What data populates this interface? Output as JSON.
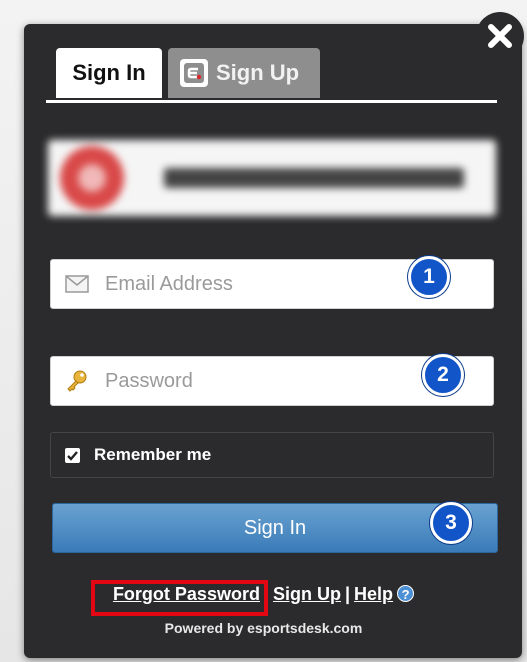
{
  "tabs": [
    {
      "label": "Sign In",
      "active": true
    },
    {
      "label": "Sign Up",
      "active": false
    }
  ],
  "form": {
    "email_placeholder": "Email Address",
    "password_placeholder": "Password",
    "remember_label": "Remember me",
    "remember_checked": true,
    "submit_label": "Sign In"
  },
  "steps": [
    "1",
    "2",
    "3"
  ],
  "footer": {
    "forgot_label": "Forgot Password",
    "signup_label": "Sign Up",
    "help_label": "Help",
    "separator": "|",
    "powered_by": "Powered by esportsdesk.com"
  },
  "colors": {
    "dialog_bg": "#2b2b2d",
    "button_blue": "#3a7bb8",
    "badge_blue": "#1155c8",
    "highlight_red": "#e30613"
  },
  "icons": {
    "close": "close-icon",
    "email": "envelope-icon",
    "password": "key-icon",
    "help": "help-icon",
    "tab_logo": "esportsdesk-logo-icon",
    "checkbox": "checkmark-icon"
  }
}
